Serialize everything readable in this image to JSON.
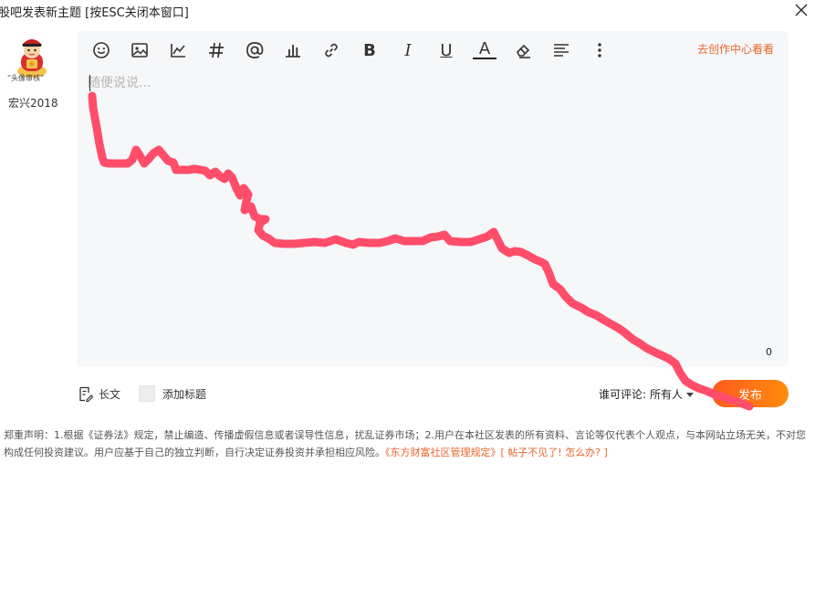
{
  "window": {
    "title": "股吧发表新主题 [按ESC关闭本窗口]"
  },
  "user": {
    "avatar_badge": "头像审核",
    "name": "宏兴2018"
  },
  "toolbar": {
    "icons": [
      "emoji-icon",
      "image-icon",
      "chart-icon",
      "hashtag-icon",
      "mention-icon",
      "bar-chart-icon",
      "link-icon",
      "bold-icon",
      "italic-icon",
      "underline-icon",
      "font-color-icon",
      "eraser-icon",
      "align-icon",
      "more-icon"
    ],
    "bold": "B",
    "italic": "I",
    "underline": "U",
    "font_color": "A",
    "creator_center_link": "去创作中心看看"
  },
  "editor": {
    "placeholder": "随便说说...",
    "value": "",
    "char_count": "0"
  },
  "options": {
    "longform_label": "长文",
    "add_title_label": "添加标题",
    "comment_permission_label": "谁可评论:",
    "comment_permission_value": "所有人"
  },
  "publish": {
    "label": "发布"
  },
  "disclaimer": {
    "text": "郑重声明：1.根据《证券法》规定，禁止编造、传播虚假信息或者误导性信息，扰乱证券市场；2.用户在本社区发表的所有资料、言论等仅代表个人观点，与本网站立场无关，不对您构成任何投资建议。用户应基于自己的独立判断，自行决定证券投资并承担相应风险。",
    "rules_link": "《东方财富社区管理规定》",
    "help_link": "[ 帖子不见了! 怎么办? ]"
  },
  "colors": {
    "accent": "#e8652c",
    "publish_gradient_start": "#ff5a1f",
    "publish_gradient_end": "#ff8c0a",
    "editor_bg": "#f6f7f9",
    "annotation_stroke": "#ff4d6a"
  }
}
